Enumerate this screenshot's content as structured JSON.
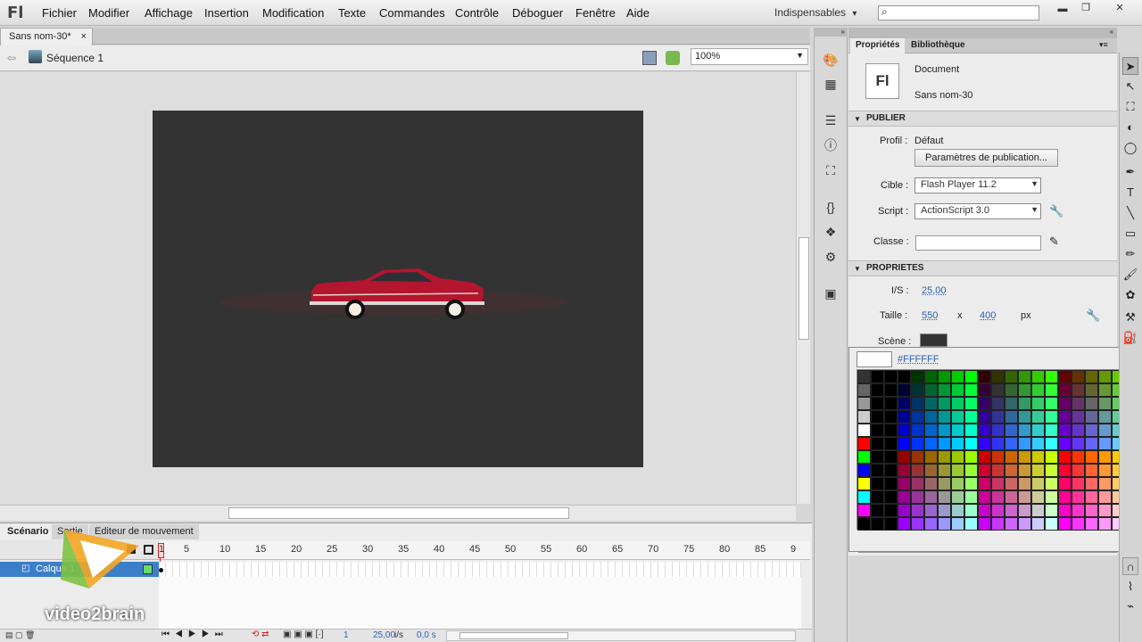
{
  "app": {
    "logo": "Fl"
  },
  "menu": [
    "Fichier",
    "Modifier",
    "Affichage",
    "Insertion",
    "Modification",
    "Texte",
    "Commandes",
    "Contrôle",
    "Déboguer",
    "Fenêtre",
    "Aide"
  ],
  "workspace": {
    "label": "Indispensables",
    "arrow": "▾"
  },
  "window_buttons": [
    "▬",
    "❐",
    "✕"
  ],
  "doc": {
    "tab": "Sans nom-30*",
    "close": "×"
  },
  "scene": {
    "name": "Séquence 1",
    "zoom": "100%"
  },
  "timeline": {
    "tabs": [
      "Scénario",
      "Sortie",
      "Editeur de mouvement"
    ],
    "frame_numbers": [
      "1",
      "5",
      "10",
      "15",
      "20",
      "25",
      "30",
      "35",
      "40",
      "45",
      "50",
      "55",
      "60",
      "65",
      "70",
      "75",
      "80",
      "85",
      "9"
    ],
    "layer": "Calque 1",
    "footer": {
      "frame": "1",
      "fps": "25,00",
      "fps_unit": "i/s",
      "time": "0,0 s"
    }
  },
  "panel": {
    "tabs": [
      "Propriétés",
      "Bibliothèque"
    ],
    "doc_icon": "Fl",
    "doc_type": "Document",
    "doc_name": "Sans nom-30",
    "publish": {
      "section": "PUBLIER",
      "profile_label": "Profil :",
      "profile_value": "Défaut",
      "settings_button": "Paramètres de publication...",
      "target_label": "Cible :",
      "target_value": "Flash Player 11.2",
      "script_label": "Script :",
      "script_value": "ActionScript 3.0",
      "class_label": "Classe :",
      "class_value": ""
    },
    "properties": {
      "section": "PROPRIETES",
      "fps_label": "I/S :",
      "fps_value": "25,00",
      "size_label": "Taille :",
      "width": "550",
      "x": "x",
      "height": "400",
      "unit": "px",
      "stage_label": "Scène :",
      "stage_color": "#333333"
    },
    "color_hex": "#FFFFFF"
  },
  "watermark": "video2brain"
}
